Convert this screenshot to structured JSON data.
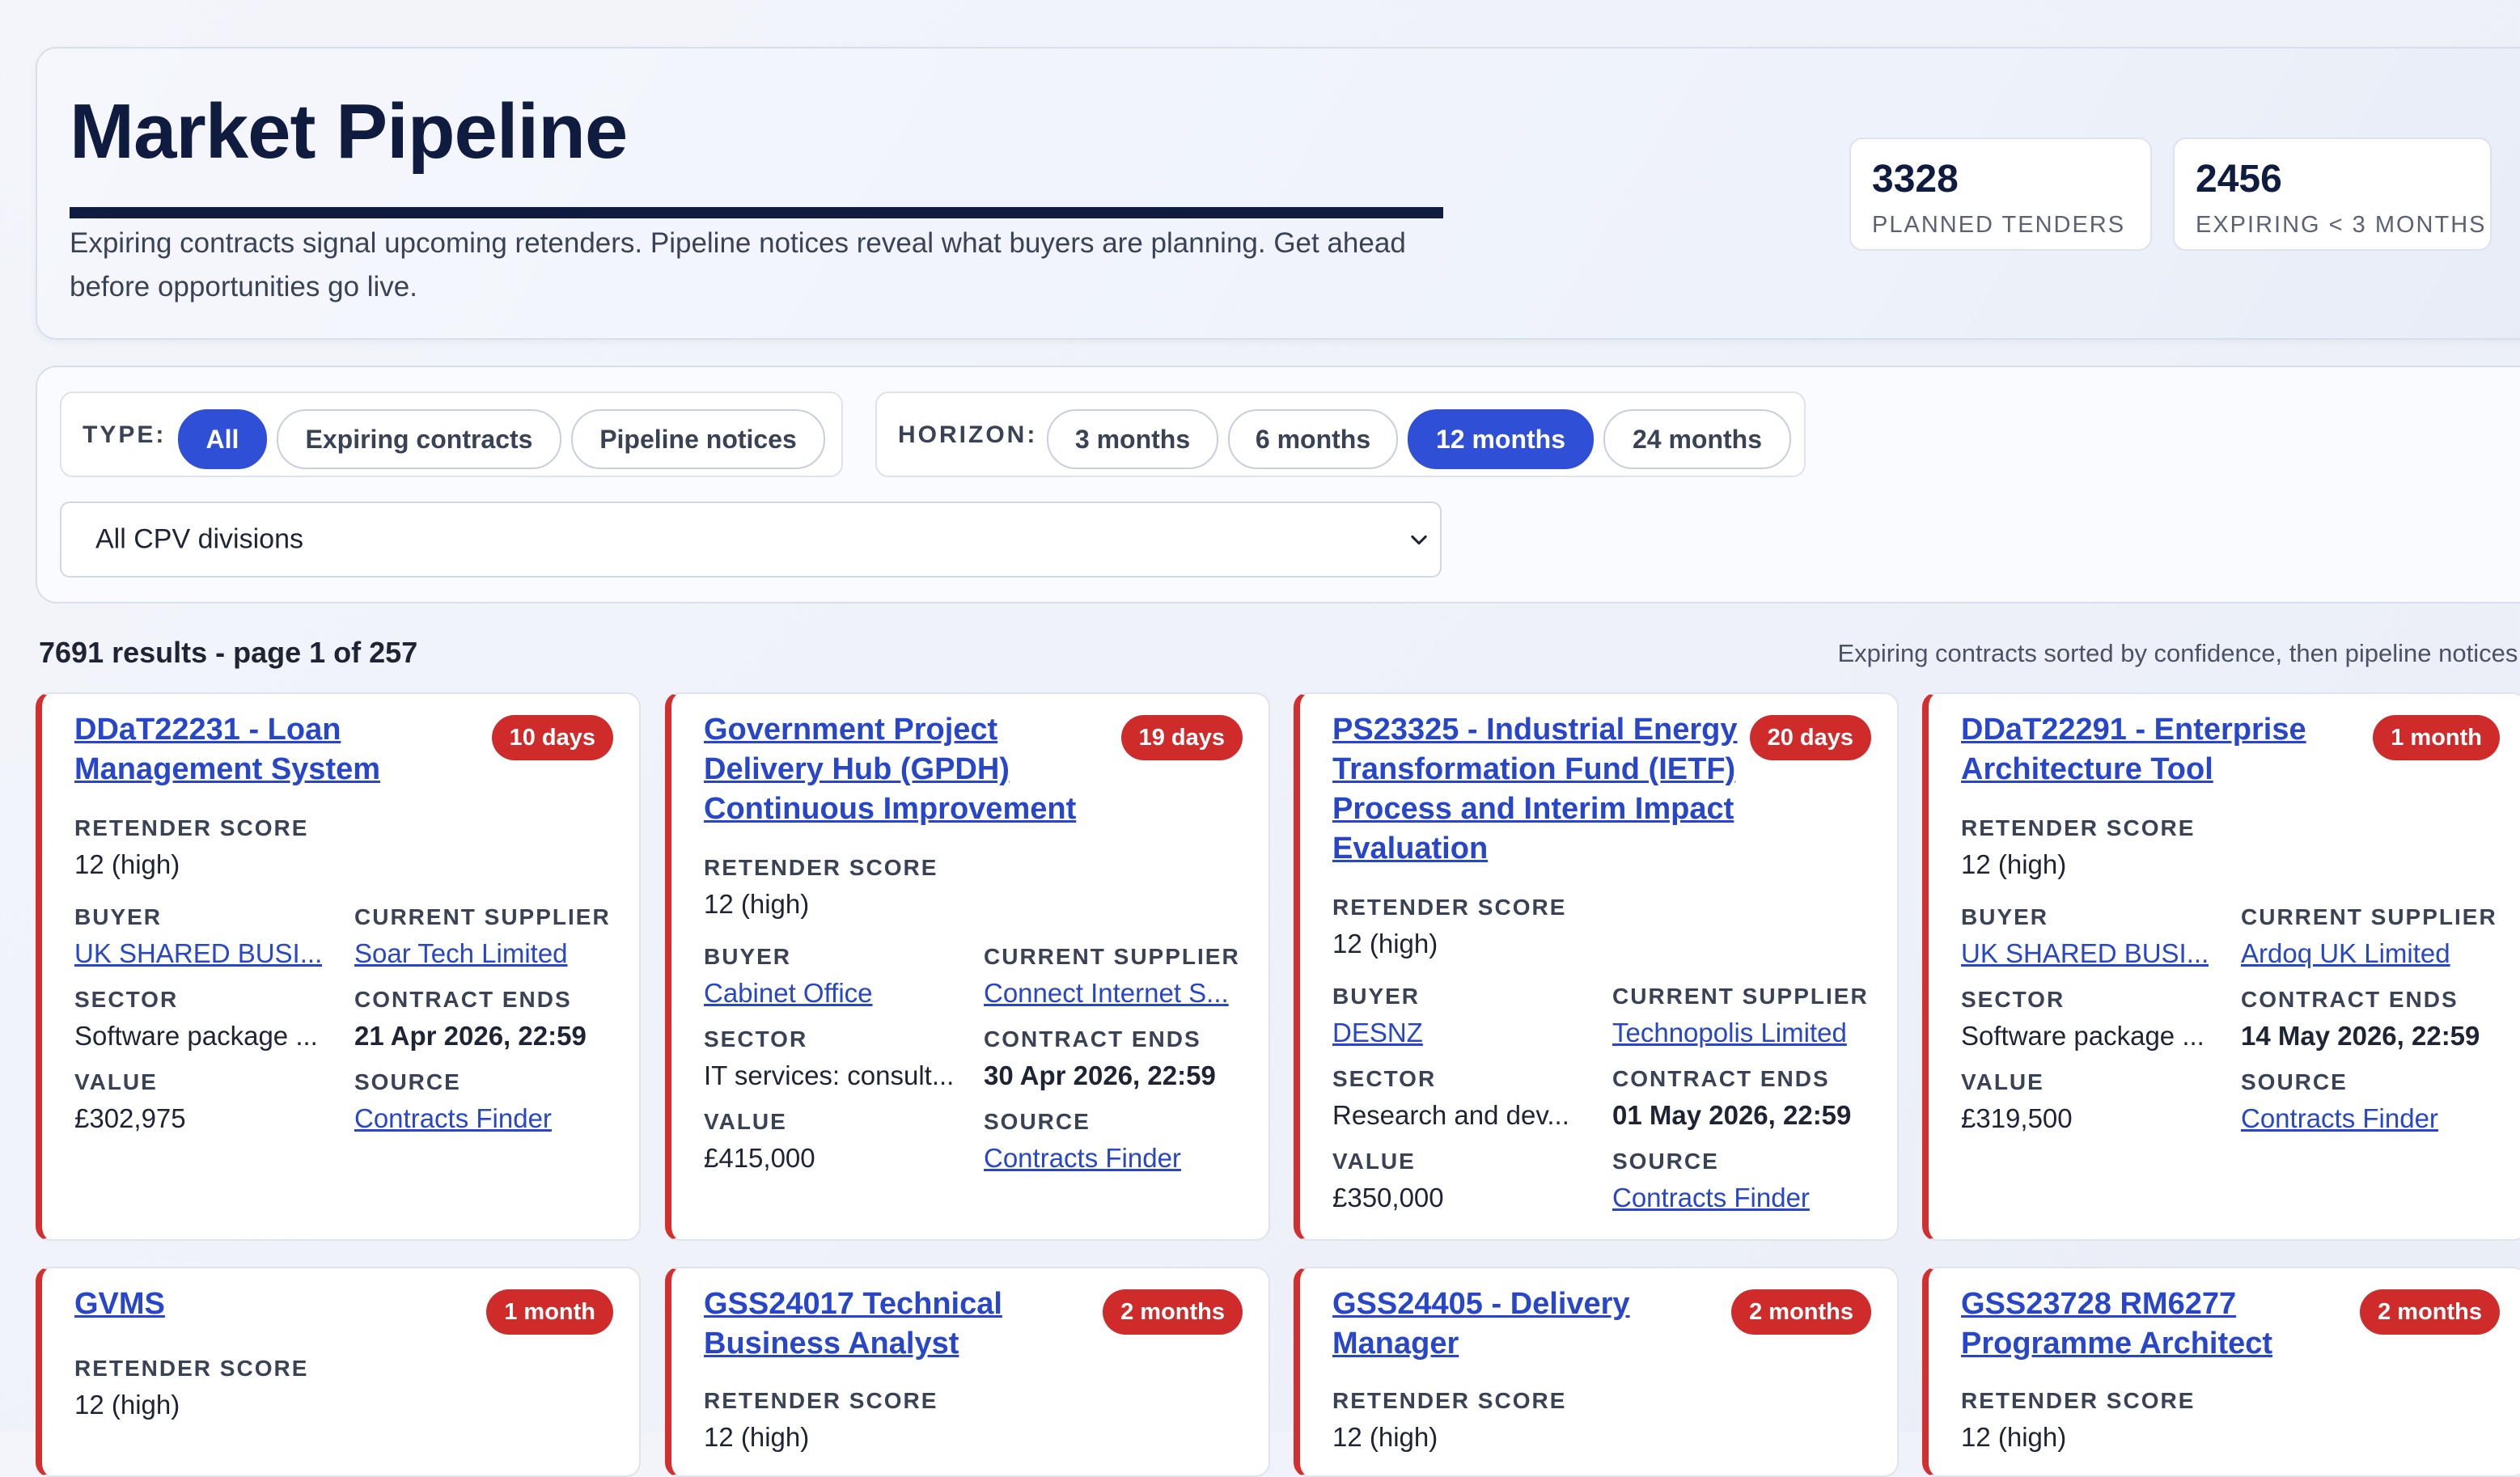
{
  "hero": {
    "title": "Market Pipeline",
    "subtitle": "Expiring contracts signal upcoming retenders. Pipeline notices reveal what buyers are planning. Get ahead before opportunities go live."
  },
  "stats": [
    {
      "value": "3328",
      "label": "PLANNED TENDERS"
    },
    {
      "value": "2456",
      "label": "EXPIRING < 3 MONTHS"
    }
  ],
  "filters": {
    "type_label": "TYPE:",
    "type_options": [
      "All",
      "Expiring contracts",
      "Pipeline notices"
    ],
    "type_selected": "All",
    "horizon_label": "HORIZON:",
    "horizon_options": [
      "3 months",
      "6 months",
      "12 months",
      "24 months"
    ],
    "horizon_selected": "12 months",
    "cpv_select": "All CPV divisions"
  },
  "results_summary": "7691 results - page 1 of 257",
  "sort_note": "Expiring contracts sorted by confidence, then pipeline notices.",
  "field_labels": {
    "retender_score": "RETENDER SCORE",
    "buyer": "BUYER",
    "current_supplier": "CURRENT SUPPLIER",
    "sector": "SECTOR",
    "contract_ends": "CONTRACT ENDS",
    "value": "VALUE",
    "source": "SOURCE"
  },
  "cards": [
    {
      "title": "DDaT22231 - Loan Management System",
      "badge": "10 days",
      "retender_score": "12 (high)",
      "buyer": "UK SHARED BUSI...",
      "current_supplier": "Soar Tech Limited",
      "sector": "Software package ...",
      "contract_ends": "21 Apr 2026, 22:59",
      "value": "£302,975",
      "source": "Contracts Finder"
    },
    {
      "title": "Government Project Delivery Hub (GPDH) Continuous Improvement",
      "badge": "19 days",
      "retender_score": "12 (high)",
      "buyer": "Cabinet Office",
      "current_supplier": "Connect Internet S...",
      "sector": "IT services: consult...",
      "contract_ends": "30 Apr 2026, 22:59",
      "value": "£415,000",
      "source": "Contracts Finder"
    },
    {
      "title": "PS23325 - Industrial Energy Transformation Fund (IETF) Process and Interim Impact Evaluation",
      "badge": "20 days",
      "retender_score": "12 (high)",
      "buyer": "DESNZ",
      "current_supplier": "Technopolis Limited",
      "sector": "Research and dev...",
      "contract_ends": "01 May 2026, 22:59",
      "value": "£350,000",
      "source": "Contracts Finder"
    },
    {
      "title": "DDaT22291 - Enterprise Architecture Tool",
      "badge": "1 month",
      "retender_score": "12 (high)",
      "buyer": "UK SHARED BUSI...",
      "current_supplier": "Ardoq UK Limited",
      "sector": "Software package ...",
      "contract_ends": "14 May 2026, 22:59",
      "value": "£319,500",
      "source": "Contracts Finder"
    },
    {
      "title": "GVMS",
      "badge": "1 month",
      "retender_score": "12 (high)"
    },
    {
      "title": "GSS24017 Technical Business Analyst",
      "badge": "2 months",
      "retender_score": "12 (high)"
    },
    {
      "title": "GSS24405 - Delivery Manager",
      "badge": "2 months",
      "retender_score": "12 (high)"
    },
    {
      "title": "GSS23728 RM6277 Programme Architect",
      "badge": "2 months",
      "retender_score": "12 (high)"
    }
  ],
  "colors": {
    "accent": "#2f4fd6",
    "badge": "#d02b2b",
    "link": "#2746c9",
    "navy": "#0f1c3f"
  }
}
